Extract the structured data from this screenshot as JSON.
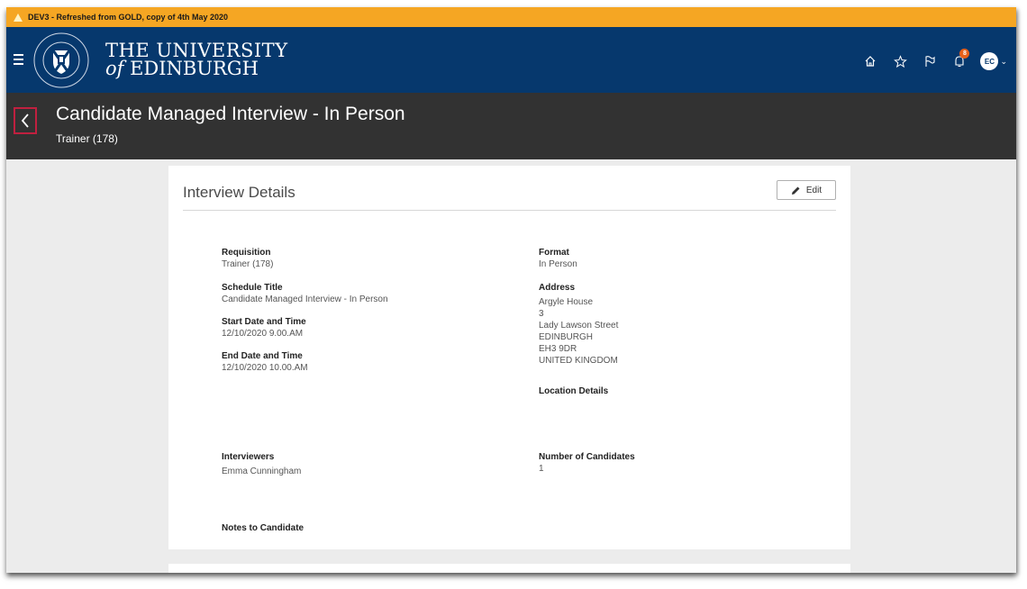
{
  "env_banner": {
    "text": "DEV3 - Refreshed from GOLD, copy of 4th May 2020"
  },
  "header": {
    "logo_line1": "THE UNIVERSITY",
    "logo_line2_italic": "of",
    "logo_line2_rest": " EDINBURGH",
    "notification_count": "8",
    "avatar_initials": "EC",
    "colors": {
      "header_bg": "#06386d",
      "banner_bg": "#f5a623",
      "badge": "#e8611a"
    }
  },
  "titlebar": {
    "title": "Candidate Managed Interview - In Person",
    "subtitle": "Trainer (178)"
  },
  "card": {
    "title": "Interview Details",
    "edit_label": "Edit",
    "left_fields": [
      {
        "label": "Requisition",
        "value": "Trainer (178)"
      },
      {
        "label": "Schedule Title",
        "value": "Candidate Managed Interview - In Person"
      },
      {
        "label": "Start Date and Time",
        "value": "12/10/2020 9.00.AM"
      },
      {
        "label": "End Date and Time",
        "value": "12/10/2020 10.00.AM"
      }
    ],
    "right_fields": {
      "format_label": "Format",
      "format_value": "In Person",
      "address_label": "Address",
      "address_lines": [
        "Argyle House",
        "3",
        "Lady Lawson Street",
        "EDINBURGH",
        "EH3 9DR",
        "UNITED KINGDOM"
      ],
      "location_label": "Location Details"
    },
    "interviewers_label": "Interviewers",
    "interviewers_value": "Emma Cunningham",
    "num_candidates_label": "Number of Candidates",
    "num_candidates_value": "1",
    "notes_label": "Notes to Candidate"
  }
}
